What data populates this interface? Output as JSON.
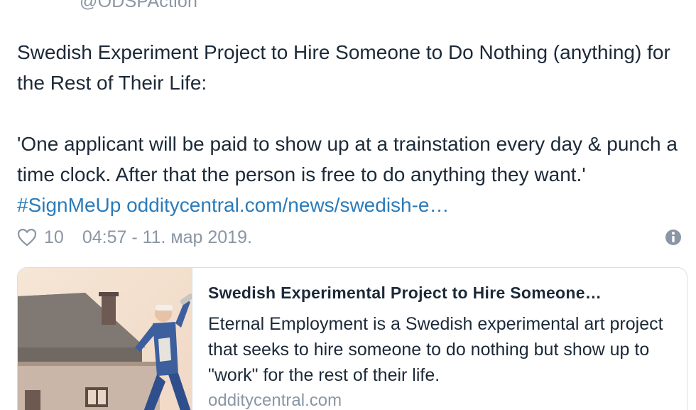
{
  "tweet": {
    "handle": "@ODSPAction",
    "text_line1": "Swedish Experiment Project to Hire Someone to Do Nothing (anything) for the Rest of Their Life:",
    "text_line2_prefix": "'One applicant will be paid to show up at a trainstation every day & punch a time clock. After that the person is free to do anything they want.'",
    "hashtag": "#SignMeUp",
    "link": "odditycentral.com/news/swedish-e…",
    "likes": "10",
    "timestamp": "04:57 - 11. мар 2019.",
    "icons": {
      "like": "heart-icon",
      "info": "info-icon"
    },
    "colors": {
      "link": "#2b7bb9",
      "muted": "#8a96a3",
      "text": "#1c2938"
    }
  },
  "card": {
    "title": "Swedish Experimental Project to Hire Someone…",
    "description": "Eternal Employment is a Swedish experimental art project that seeks to hire someone to do nothing but show up to \"work\" for the rest of their life.",
    "domain": "odditycentral.com"
  }
}
